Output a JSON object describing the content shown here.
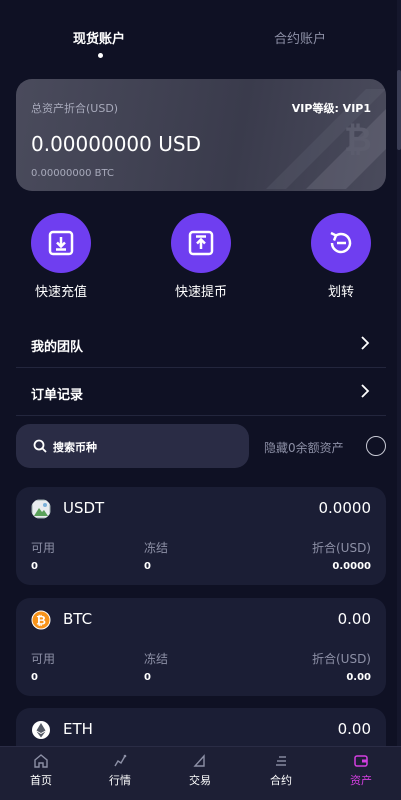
{
  "tabs": {
    "spot": "现货账户",
    "contract": "合约账户"
  },
  "asset_card": {
    "label": "总资产折合(USD)",
    "vip": "VIP等级: VIP1",
    "amount": "0.00000000 USD",
    "btc": "0.00000000 BTC"
  },
  "actions": {
    "deposit": "快速充值",
    "withdraw": "快速提币",
    "transfer": "划转"
  },
  "menu": {
    "team": "我的团队",
    "orders": "订单记录"
  },
  "search": {
    "placeholder": "搜索币种",
    "hide_zero": "隐藏0余额资产"
  },
  "columns": {
    "available": "可用",
    "frozen": "冻结",
    "equivalent": "折合(USD)"
  },
  "coins": [
    {
      "name": "USDT",
      "total": "0.0000",
      "available": "0",
      "frozen": "0",
      "equivalent": "0.0000"
    },
    {
      "name": "BTC",
      "total": "0.00",
      "available": "0",
      "frozen": "0",
      "equivalent": "0.00"
    },
    {
      "name": "ETH",
      "total": "0.00"
    }
  ],
  "nav": {
    "home": "首页",
    "market": "行情",
    "trade": "交易",
    "contract": "合约",
    "assets": "资产"
  },
  "colors": {
    "background": "#0f1124",
    "accent": "#6f3ef0",
    "nav_active": "#d33fe0",
    "card": "#1b1e35"
  }
}
